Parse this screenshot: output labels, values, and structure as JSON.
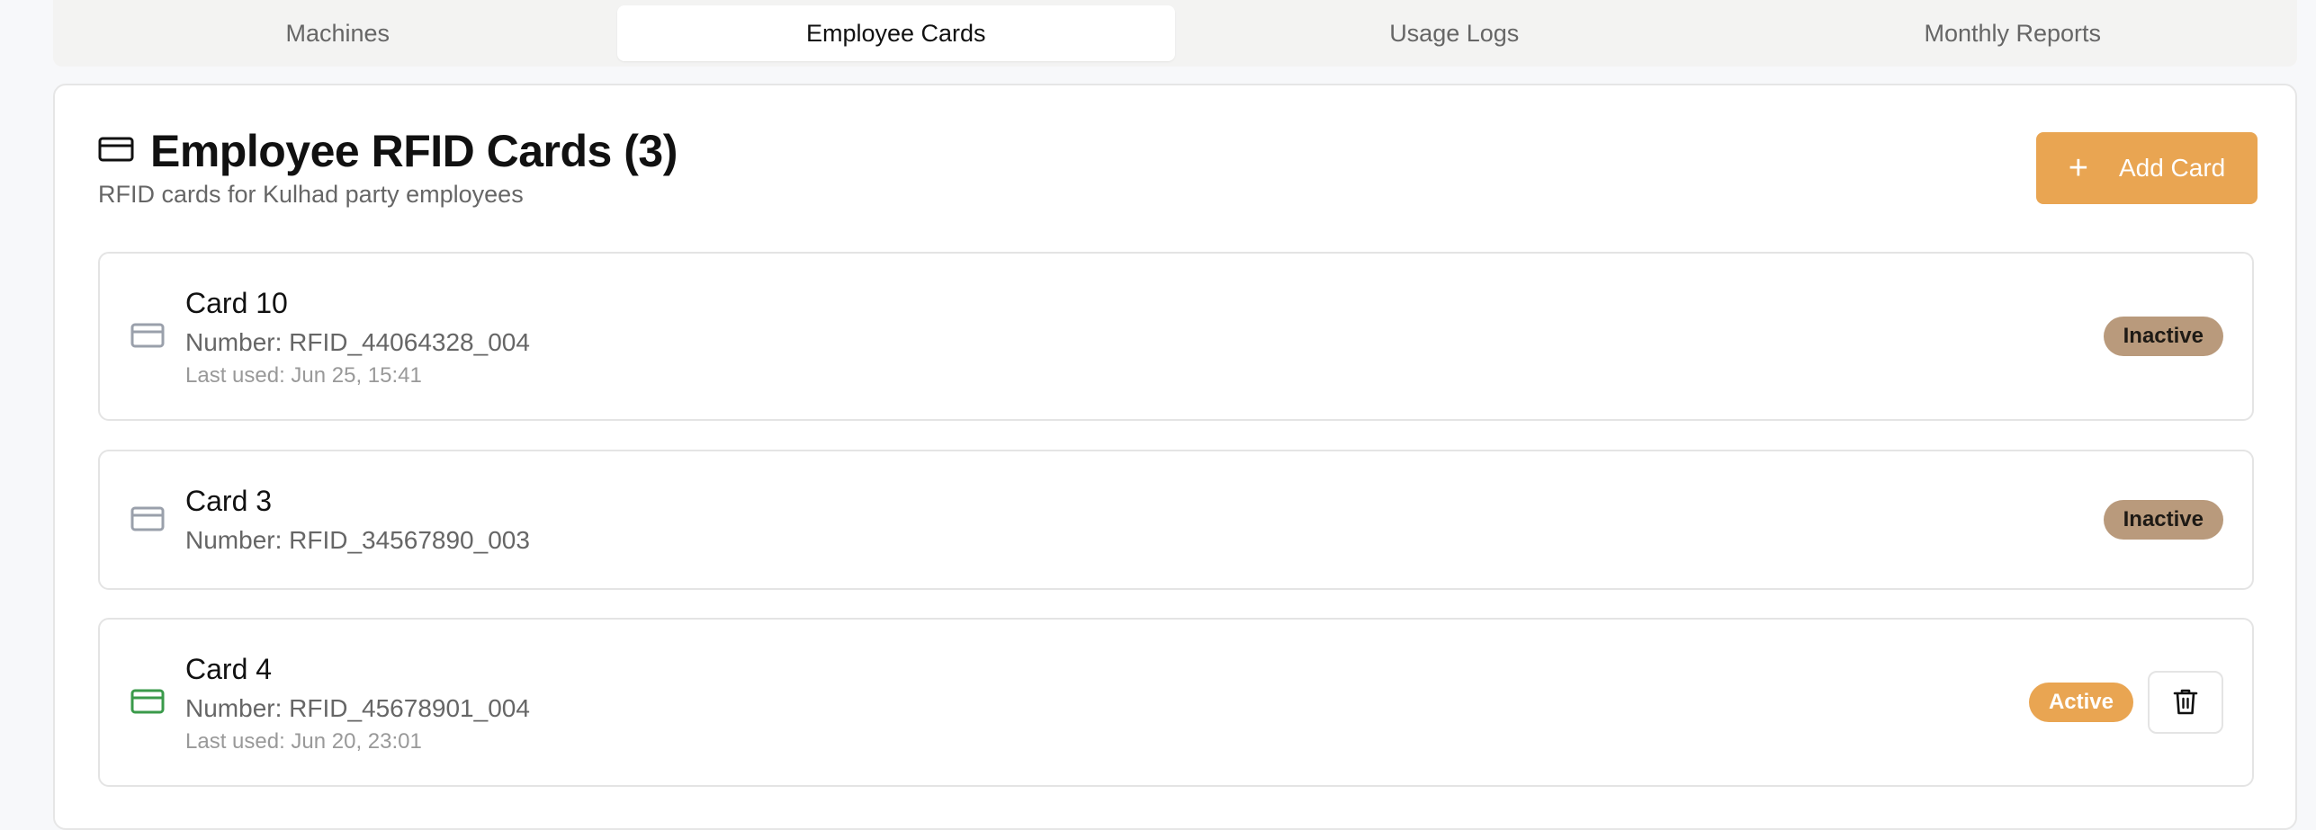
{
  "tabs": [
    {
      "label": "Machines",
      "active": false
    },
    {
      "label": "Employee Cards",
      "active": true
    },
    {
      "label": "Usage Logs",
      "active": false
    },
    {
      "label": "Monthly Reports",
      "active": false
    }
  ],
  "header": {
    "title": "Employee RFID Cards (3)",
    "subtitle": "RFID cards for Kulhad party employees",
    "title_icon": "credit-card-icon"
  },
  "add_button": {
    "label": "Add Card",
    "icon": "plus-icon"
  },
  "cards": [
    {
      "name": "Card 10",
      "number": "Number: RFID_44064328_004",
      "last_used": "Last used: Jun 25, 15:41",
      "status": "Inactive",
      "icon_color": "#9aa0ab"
    },
    {
      "name": "Card 3",
      "number": "Number: RFID_34567890_003",
      "last_used": "",
      "status": "Inactive",
      "icon_color": "#9aa0ab"
    },
    {
      "name": "Card 4",
      "number": "Number: RFID_45678901_004",
      "last_used": "Last used: Jun 20, 23:01",
      "status": "Active",
      "icon_color": "#3a9a4a"
    }
  ],
  "colors": {
    "accent": "#e9a552",
    "inactive_badge": "#b99a7c",
    "active_card_icon": "#3a9a4a"
  }
}
